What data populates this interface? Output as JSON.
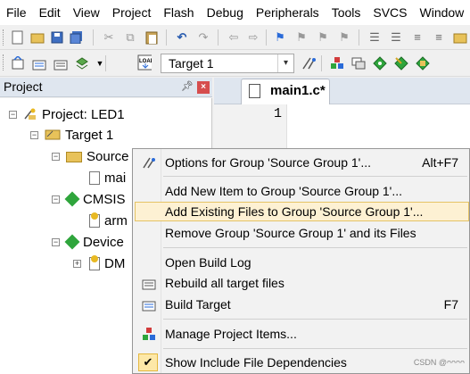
{
  "menubar": {
    "items": [
      "File",
      "Edit",
      "View",
      "Project",
      "Flash",
      "Debug",
      "Peripherals",
      "Tools",
      "SVCS",
      "Window"
    ]
  },
  "toolbar": {
    "target_label": "Target 1"
  },
  "project_panel": {
    "title": "Project",
    "pin_icon": "pin-icon",
    "close_icon": "close-icon"
  },
  "tree": {
    "project": "Project: LED1",
    "target": "Target 1",
    "source_group": "Source",
    "source_file": "mai",
    "cmsis": "CMSIS",
    "cmsis_file": "arm",
    "device": "Device",
    "device_file": "DM"
  },
  "editor": {
    "tab_label": "main1.c*",
    "line_number": "1"
  },
  "context_menu": {
    "items": [
      {
        "label": "Options for Group 'Source Group 1'...",
        "shortcut": "Alt+F7",
        "icon": "options-icon"
      },
      {
        "label": "Add New  Item to Group 'Source Group 1'...",
        "shortcut": "",
        "icon": ""
      },
      {
        "label": "Add Existing Files to Group 'Source Group 1'...",
        "shortcut": "",
        "icon": "",
        "highlighted": true
      },
      {
        "label": "Remove Group 'Source Group 1' and its Files",
        "shortcut": "",
        "icon": ""
      },
      {
        "label": "Open Build Log",
        "shortcut": "",
        "icon": ""
      },
      {
        "label": "Rebuild all target files",
        "shortcut": "",
        "icon": "rebuild-icon"
      },
      {
        "label": "Build Target",
        "shortcut": "F7",
        "icon": "build-icon"
      },
      {
        "label": "Manage Project Items...",
        "shortcut": "",
        "icon": "manage-items-icon"
      },
      {
        "label": "Show Include File Dependencies",
        "shortcut": "",
        "icon": "checkmark-icon",
        "checked": true
      }
    ]
  },
  "watermark": "CSDN @ᴖᴖᴖᴖ",
  "colors": {
    "highlight_bg": "#fdf1d3",
    "highlight_border": "#e5c365",
    "panel_header": "#dfe6ef"
  }
}
